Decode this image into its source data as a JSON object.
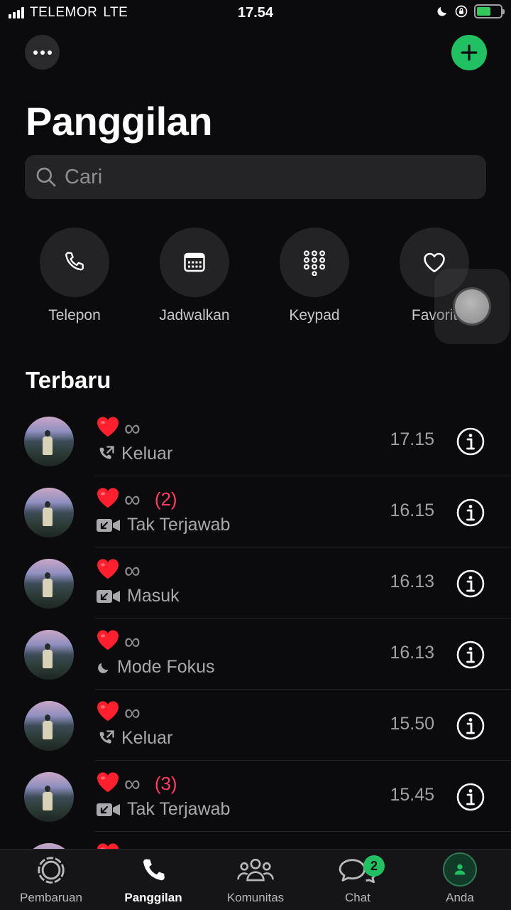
{
  "status_bar": {
    "carrier": "TELEMOR",
    "network": "LTE",
    "time": "17.54",
    "battery_level": 0.6
  },
  "header": {
    "more_icon": "ellipsis-icon",
    "add_icon": "plus-icon",
    "title": "Panggilan"
  },
  "search": {
    "placeholder": "Cari",
    "value": ""
  },
  "quick_actions": [
    {
      "label": "Telepon",
      "icon": "phone-icon"
    },
    {
      "label": "Jadwalkan",
      "icon": "calendar-icon"
    },
    {
      "label": "Keypad",
      "icon": "keypad-icon"
    },
    {
      "label": "Favorit",
      "icon": "heart-outline-icon"
    }
  ],
  "recent": {
    "title": "Terbaru",
    "items": [
      {
        "name_symbol": "∞",
        "count": "",
        "type_icon": "outgoing-call-icon",
        "type": "Keluar",
        "time": "17.15"
      },
      {
        "name_symbol": "∞",
        "count": "(2)",
        "type_icon": "missed-video-icon",
        "type": "Tak Terjawab",
        "time": "16.15"
      },
      {
        "name_symbol": "∞",
        "count": "",
        "type_icon": "incoming-video-icon",
        "type": "Masuk",
        "time": "16.13"
      },
      {
        "name_symbol": "∞",
        "count": "",
        "type_icon": "moon-icon",
        "type": "Mode Fokus",
        "time": "16.13"
      },
      {
        "name_symbol": "∞",
        "count": "",
        "type_icon": "outgoing-call-icon",
        "type": "Keluar",
        "time": "15.50"
      },
      {
        "name_symbol": "∞",
        "count": "(3)",
        "type_icon": "missed-video-icon",
        "type": "Tak Terjawab",
        "time": "15.45"
      }
    ]
  },
  "tabs": [
    {
      "label": "Pembaruan",
      "icon": "updates-icon",
      "active": false
    },
    {
      "label": "Panggilan",
      "icon": "phone-icon",
      "active": true
    },
    {
      "label": "Komunitas",
      "icon": "community-icon",
      "active": false
    },
    {
      "label": "Chat",
      "icon": "chat-icon",
      "active": false,
      "badge": "2"
    },
    {
      "label": "Anda",
      "icon": "profile-icon",
      "active": false
    }
  ],
  "colors": {
    "accent": "#21c063",
    "background": "#0b0b0d",
    "missed_count": "#ff3b63",
    "heart": "#ff1f2d"
  }
}
